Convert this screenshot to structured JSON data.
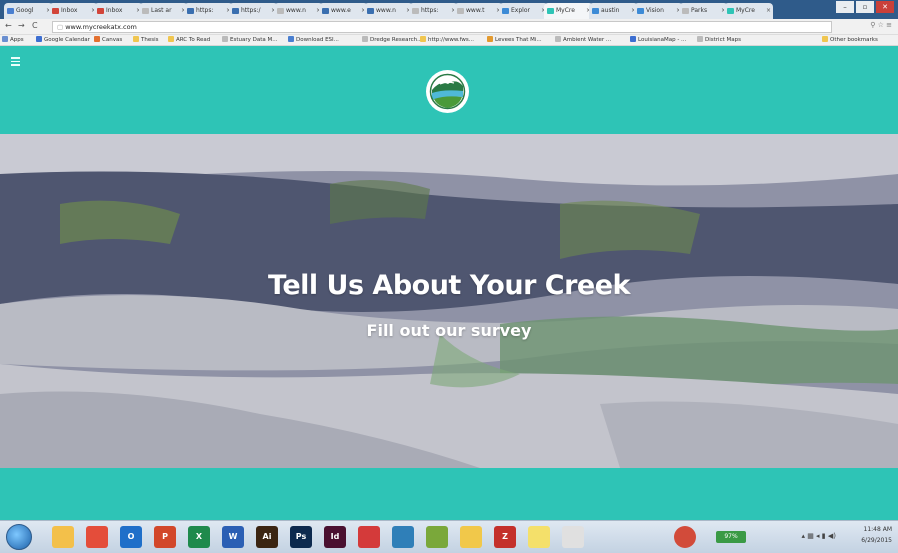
{
  "browser": {
    "tabs": [
      {
        "label": "Googl",
        "color": "#4a7fd0"
      },
      {
        "label": "Inbox",
        "color": "#d2453a"
      },
      {
        "label": "Inbox",
        "color": "#d2453a"
      },
      {
        "label": "Last ar",
        "color": "#bbbbbb"
      },
      {
        "label": "https:",
        "color": "#3a6fb0"
      },
      {
        "label": "https:/",
        "color": "#3a6fb0"
      },
      {
        "label": "www.n",
        "color": "#bbbbbb"
      },
      {
        "label": "www.e",
        "color": "#3a6fb0"
      },
      {
        "label": "www.n",
        "color": "#3a6fb0"
      },
      {
        "label": "https:",
        "color": "#bbbbbb"
      },
      {
        "label": "www.t",
        "color": "#bbbbbb"
      },
      {
        "label": "Explor",
        "color": "#3d8bd6"
      },
      {
        "label": "MyCre",
        "color": "#2ec4b6"
      },
      {
        "label": "austin",
        "color": "#3d8bd6"
      },
      {
        "label": "Vision",
        "color": "#3d8bd6"
      },
      {
        "label": "Parks",
        "color": "#bbbbbb"
      },
      {
        "label": "MyCre",
        "color": "#2ec4b6"
      }
    ],
    "url": "www.mycreekatx.com",
    "bookmarks": [
      {
        "label": "Apps",
        "color": "#6a8fd0"
      },
      {
        "label": "Google Calendar",
        "color": "#3d6fd1"
      },
      {
        "label": "Canvas",
        "color": "#e3702f"
      },
      {
        "label": "Thesis",
        "color": "#f0c650"
      },
      {
        "label": "ARC To Read",
        "color": "#f0c650"
      },
      {
        "label": "Estuary Data M...",
        "color": "#bbbbbb"
      },
      {
        "label": "Download ESI...",
        "color": "#4a7fd0"
      },
      {
        "label": "Dredge Research...",
        "color": "#bbbbbb"
      },
      {
        "label": "http://www.fws...",
        "color": "#f0c650"
      },
      {
        "label": "Levees That Mi...",
        "color": "#e39a2f"
      },
      {
        "label": "Ambient Water ...",
        "color": "#bbbbbb"
      },
      {
        "label": "LouisianaMap - ...",
        "color": "#3d6fd1"
      },
      {
        "label": "District Maps",
        "color": "#bbbbbb"
      },
      {
        "label": "Other bookmarks",
        "color": "#f0c650"
      }
    ]
  },
  "hero": {
    "title": "Tell Us About Your Creek",
    "subtitle": "Fill out our survey"
  },
  "colors": {
    "accent": "#2ec4b6",
    "overlay": "#8c8fa3"
  },
  "taskbar": {
    "apps": [
      {
        "name": "explorer",
        "color": "#f3c04a",
        "glyph": ""
      },
      {
        "name": "chrome",
        "color": "#e44d3a",
        "glyph": ""
      },
      {
        "name": "outlook",
        "color": "#1f6fc9",
        "glyph": "O"
      },
      {
        "name": "powerpoint",
        "color": "#d2472a",
        "glyph": "P"
      },
      {
        "name": "excel",
        "color": "#1f8a4c",
        "glyph": "X"
      },
      {
        "name": "word",
        "color": "#2b5fb4",
        "glyph": "W"
      },
      {
        "name": "illustrator",
        "color": "#3b2512",
        "glyph": "Ai"
      },
      {
        "name": "photoshop",
        "color": "#0d2a4e",
        "glyph": "Ps"
      },
      {
        "name": "indesign",
        "color": "#4a1030",
        "glyph": "Id"
      },
      {
        "name": "app-red",
        "color": "#d43a3a",
        "glyph": ""
      },
      {
        "name": "app-globe",
        "color": "#2f7fb8",
        "glyph": ""
      },
      {
        "name": "app-arcgis",
        "color": "#7aa83a",
        "glyph": ""
      },
      {
        "name": "google-drive",
        "color": "#f1c84a",
        "glyph": ""
      },
      {
        "name": "app-z",
        "color": "#c4302b",
        "glyph": "Z"
      },
      {
        "name": "app-star",
        "color": "#f4e06a",
        "glyph": ""
      },
      {
        "name": "acrobat",
        "color": "#e0e0e0",
        "glyph": ""
      }
    ],
    "battery": "97%",
    "time": "11:48 AM",
    "date": "6/29/2015"
  }
}
